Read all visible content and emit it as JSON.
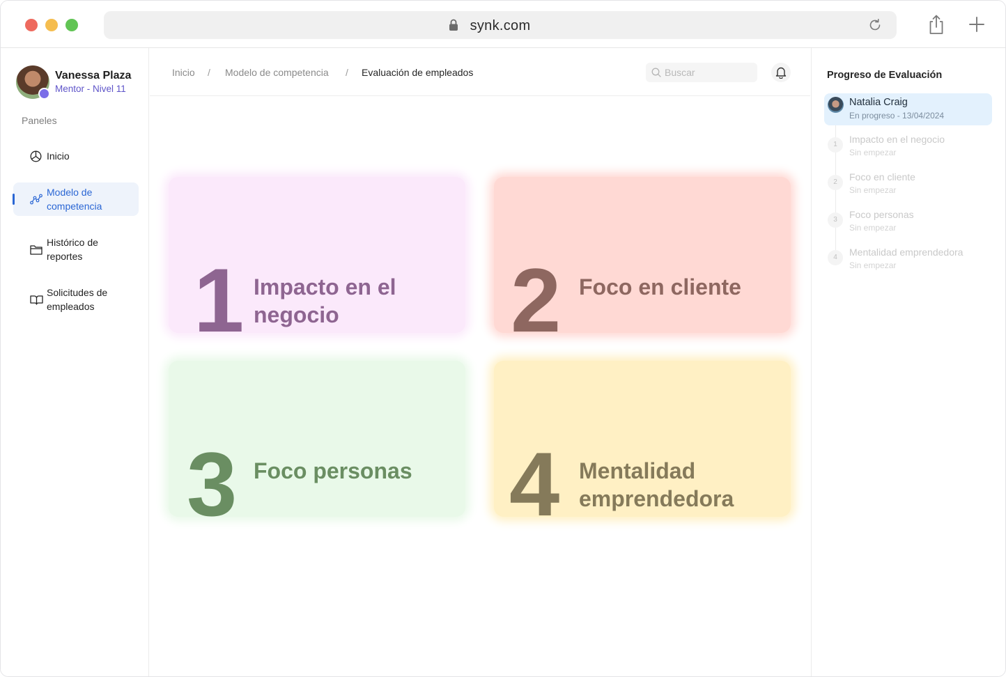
{
  "browser": {
    "url": "synk.com"
  },
  "user": {
    "name": "Vanessa Plaza",
    "role": "Mentor - Nivel 11"
  },
  "sidebar": {
    "section_label": "Paneles",
    "items": [
      {
        "label": "Inicio",
        "icon": "pie-chart-icon"
      },
      {
        "label": "Modelo de competencia",
        "icon": "graph-nodes-icon",
        "active": true
      },
      {
        "label": "Histórico de reportes",
        "icon": "folder-icon"
      },
      {
        "label": "Solicitudes de empleados",
        "icon": "book-icon"
      }
    ]
  },
  "breadcrumb": {
    "items": [
      "Inicio",
      "Modelo de competencia",
      "Evaluación de empleados"
    ],
    "separator": "/"
  },
  "search": {
    "placeholder": "Buscar"
  },
  "cards": [
    {
      "number": "1",
      "title": "Impacto en el negocio",
      "bg": "#fbe9fb",
      "color": "#8e6591"
    },
    {
      "number": "2",
      "title": "Foco en cliente",
      "bg": "#ffd9d4",
      "color": "#8e6760"
    },
    {
      "number": "3",
      "title": "Foco personas",
      "bg": "#e9f9e9",
      "color": "#6a8e62"
    },
    {
      "number": "4",
      "title": "Mentalidad emprendedora",
      "bg": "#fff0c4",
      "color": "#857a5a"
    }
  ],
  "progress_panel": {
    "title": "Progreso de Evaluación",
    "person": {
      "name": "Natalia Craig",
      "status": "En progreso - 13/04/2024"
    },
    "steps": [
      {
        "index": "1",
        "name": "Impacto en el negocio",
        "status": "Sin empezar"
      },
      {
        "index": "2",
        "name": "Foco en cliente",
        "status": "Sin empezar"
      },
      {
        "index": "3",
        "name": "Foco personas",
        "status": "Sin empezar"
      },
      {
        "index": "4",
        "name": "Mentalidad emprendedora",
        "status": "Sin empezar"
      }
    ]
  }
}
